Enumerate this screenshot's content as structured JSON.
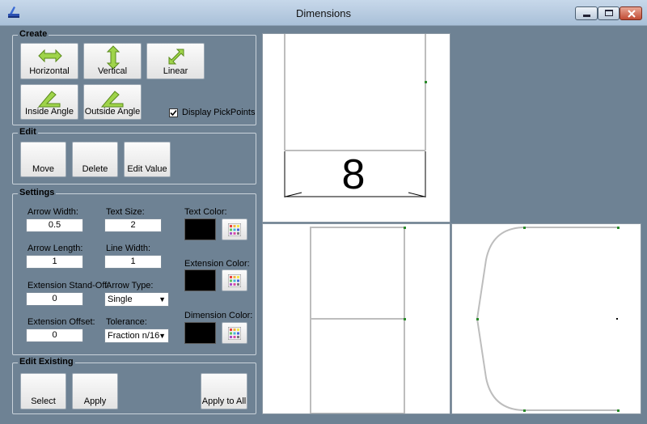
{
  "window": {
    "title": "Dimensions"
  },
  "create": {
    "title": "Create",
    "horizontal": "Horizontal",
    "vertical": "Vertical",
    "linear": "Linear",
    "inside_angle": "Inside Angle",
    "outside_angle": "Outside Angle",
    "display_pickpoints": "Display PickPoints",
    "display_pickpoints_checked": true
  },
  "edit": {
    "title": "Edit",
    "move": "Move",
    "delete": "Delete",
    "edit_value": "Edit Value"
  },
  "settings": {
    "title": "Settings",
    "arrow_width_label": "Arrow Width:",
    "arrow_width": "0.5",
    "text_size_label": "Text Size:",
    "text_size": "2",
    "text_color_label": "Text Color:",
    "text_color": "#000000",
    "arrow_length_label": "Arrow Length:",
    "arrow_length": "1",
    "line_width_label": "Line Width:",
    "line_width": "1",
    "extension_color_label": "Extension Color:",
    "extension_color": "#000000",
    "extension_standoff_label": "Extension Stand-Off:",
    "extension_standoff": "0",
    "arrow_type_label": "Arrow Type:",
    "arrow_type": "Single",
    "extension_offset_label": "Extension Offset:",
    "extension_offset": "0",
    "tolerance_label": "Tolerance:",
    "tolerance": "Fraction n/16",
    "dimension_color_label": "Dimension Color:",
    "dimension_color": "#000000"
  },
  "edit_existing": {
    "title": "Edit Existing",
    "select": "Select",
    "apply": "Apply",
    "apply_to_all": "Apply to All"
  },
  "viewport_top": {
    "dimension_text": "8"
  },
  "colors": {
    "accent_green": "#8cc63f",
    "background": "#6e8294"
  }
}
